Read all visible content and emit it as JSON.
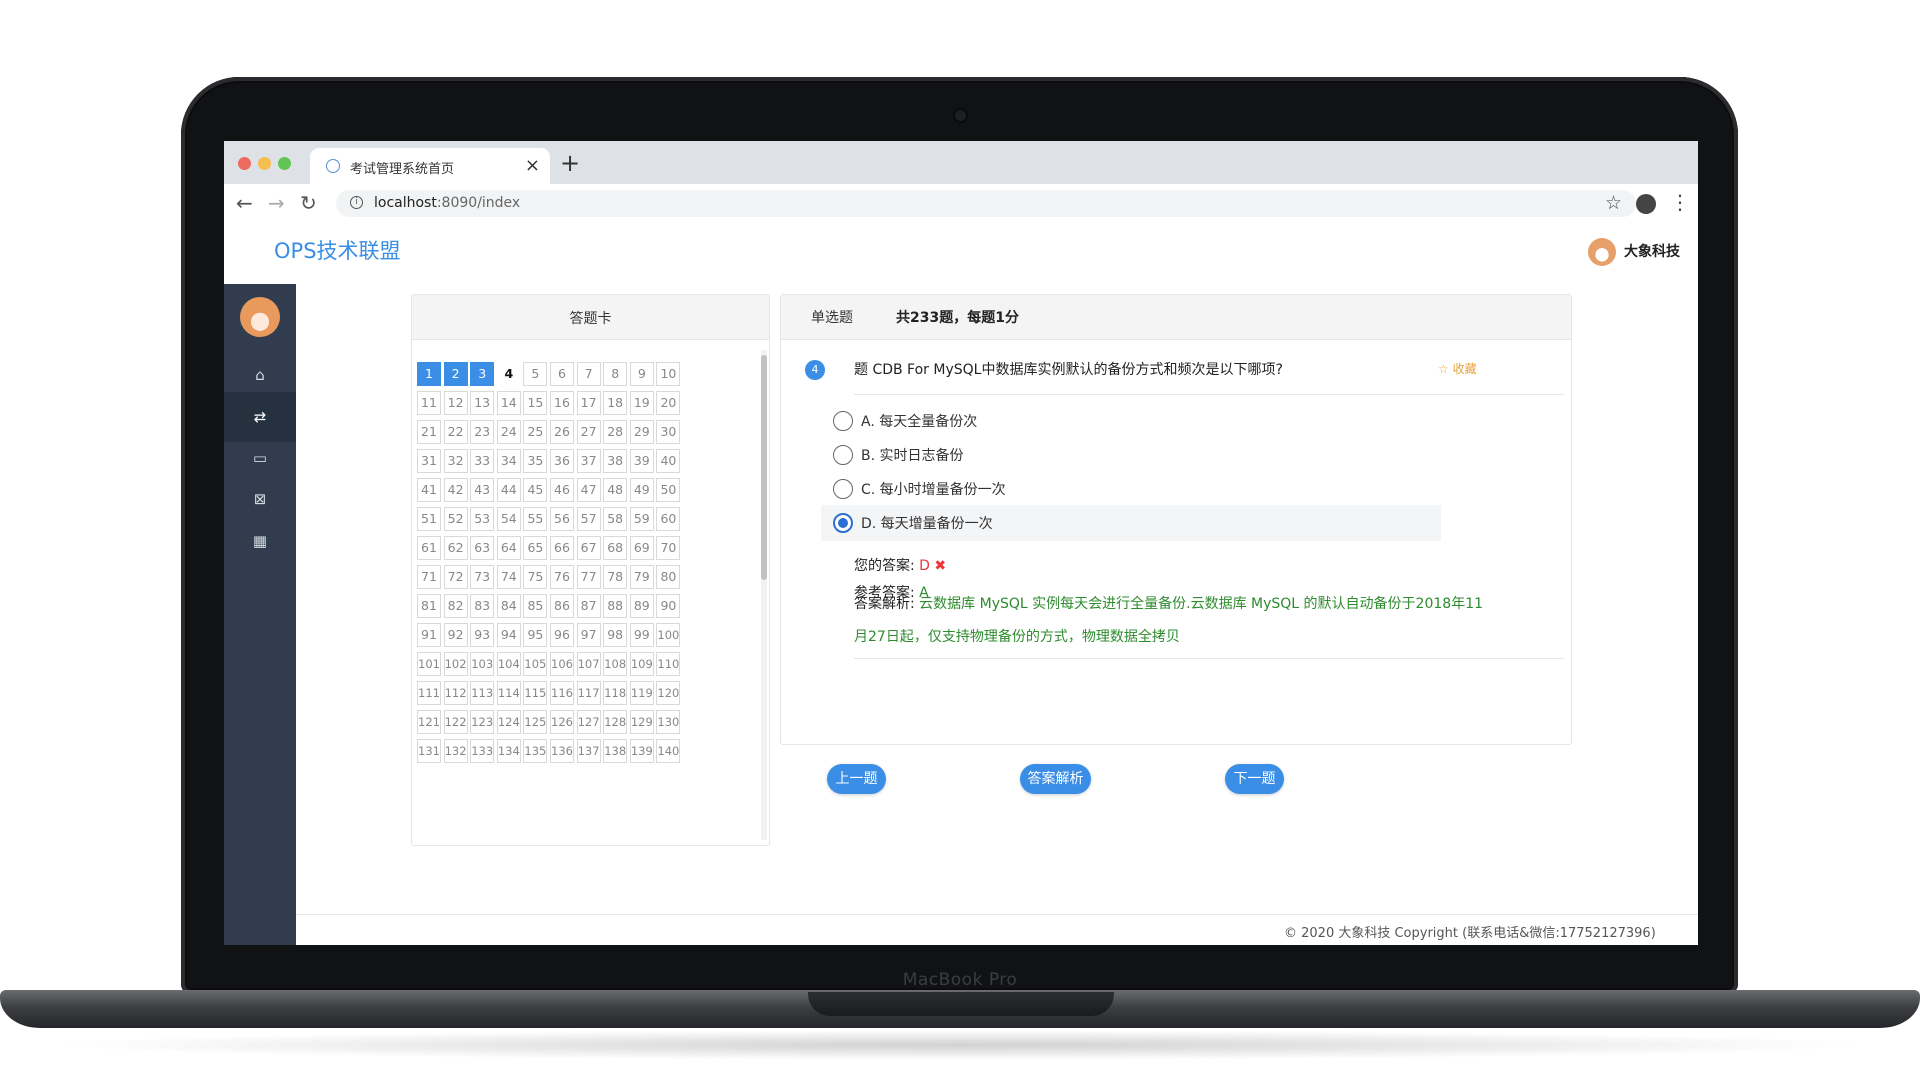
{
  "browser": {
    "tab_title": "考试管理系统首页",
    "url_host": "localhost",
    "url_path": ":8090/index"
  },
  "header": {
    "brand": "OPS技术联盟",
    "user_name": "大象科技"
  },
  "sidebar": {
    "items": [
      {
        "icon": "home-icon",
        "glyph": "⌂"
      },
      {
        "icon": "exchange-icon",
        "glyph": "⇄"
      },
      {
        "icon": "monitor-icon",
        "glyph": "▭"
      },
      {
        "icon": "close-box-icon",
        "glyph": "⊠"
      },
      {
        "icon": "table-icon",
        "glyph": "▦"
      }
    ]
  },
  "answer_card": {
    "title": "答题卡",
    "answered": [
      1,
      2,
      3
    ],
    "current": 4,
    "visible_count": 140
  },
  "question": {
    "type": "单选题",
    "total": "共233题，每题1分",
    "number": "4",
    "text": "题 CDB For MySQL中数据库实例默认的备份方式和频次是以下哪项?",
    "favorite": "☆ 收藏",
    "options": [
      {
        "label": "A. 每天全量备份次",
        "selected": false
      },
      {
        "label": "B. 实时日志备份",
        "selected": false
      },
      {
        "label": "C. 每小时增量备份一次",
        "selected": false
      },
      {
        "label": "D. 每天增量备份一次",
        "selected": true
      }
    ],
    "your_answer_label": "您的答案:",
    "your_answer": "D",
    "wrong_mark": "✖",
    "reference_label": "参考答案:",
    "reference_answer": "A",
    "analysis_label": "答案解析:",
    "analysis_text": "云数据库 MySQL 实例每天会进行全量备份.云数据库 MySQL 的默认自动备份于2018年11月27日起，仅支持物理备份的方式，物理数据全拷贝"
  },
  "buttons": {
    "prev": "上一题",
    "analysis": "答案解析",
    "next": "下一题"
  },
  "footer": {
    "text": "© 2020 大象科技 Copyright (联系电话&微信:17752127396)"
  },
  "device": {
    "label": "MacBook Pro"
  },
  "colors": {
    "accent": "#3a8ee6",
    "sidebar": "#313d4e",
    "wrong": "#e33333",
    "correct": "#2e8b2e"
  }
}
